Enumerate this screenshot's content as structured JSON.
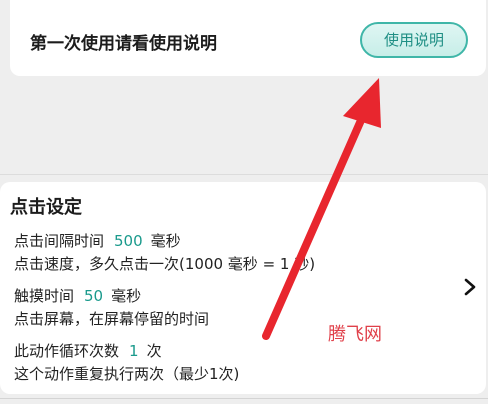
{
  "top_card": {
    "prompt_text": "第一次使用请看使用说明",
    "help_button_label": "使用说明"
  },
  "settings": {
    "title": "点击设定",
    "interval": {
      "label": "点击间隔时间",
      "value": "500",
      "unit": "毫秒",
      "description": "点击速度，多久点击一次(1000 毫秒 = 1 秒)"
    },
    "touch_time": {
      "label": "触摸时间",
      "value": "50",
      "unit": "毫秒",
      "description": "点击屏幕，在屏幕停留的时间"
    },
    "loop_count": {
      "label": "此动作循环次数",
      "value": "1",
      "unit": "次",
      "description": "这个动作重复执行两次（最少1次)"
    }
  },
  "watermark": "腾飞网",
  "icons": {
    "chevron": "chevron-right-icon",
    "annotation_arrow": "red-arrow-annotation"
  },
  "colors": {
    "accent": "#1a9a8c",
    "button_border": "#3fb6a8",
    "annotation": "#e8262e"
  }
}
